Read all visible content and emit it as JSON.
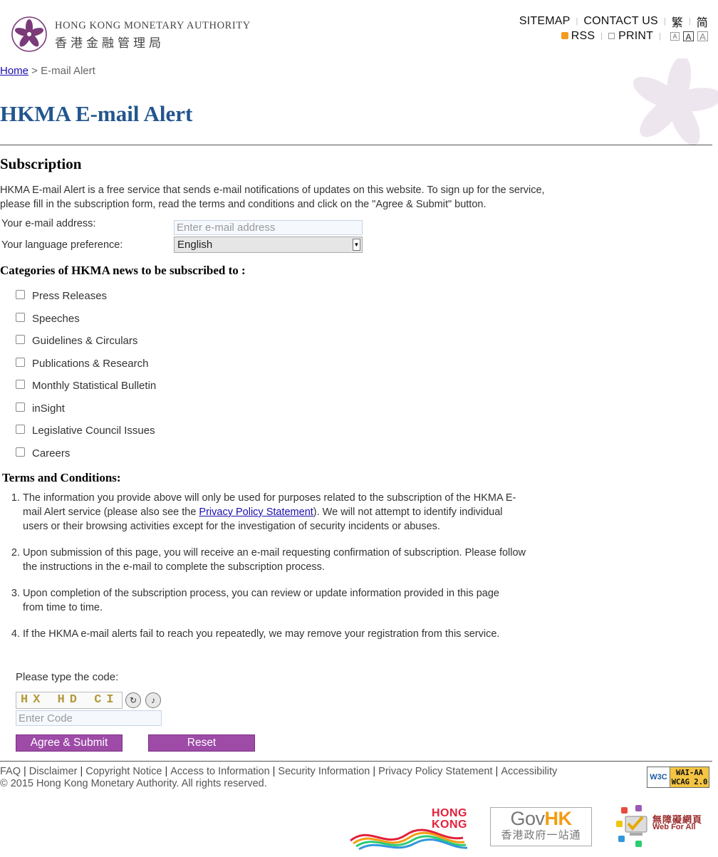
{
  "header": {
    "org_name_en": "HONG KONG MONETARY AUTHORITY",
    "org_name_zh": "香港金融管理局",
    "sitemap": "SITEMAP",
    "contact_us": "CONTACT US",
    "lang_tc": "繁",
    "lang_sc": "简",
    "rss": "RSS",
    "print": "PRINT",
    "font_small": "A",
    "font_medium": "A",
    "font_large": "A"
  },
  "breadcrumb": {
    "home": "Home",
    "separator": " > ",
    "current": "E-mail Alert"
  },
  "page": {
    "title": "HKMA E-mail Alert",
    "subscription_heading": "Subscription",
    "intro": "HKMA E-mail Alert is a free service that sends e-mail notifications of updates on this website. To sign up for the service, please fill in the subscription form, read the terms and conditions and click on the \"Agree & Submit\" button."
  },
  "form": {
    "email_label": "Your e-mail address:",
    "email_placeholder": "Enter e-mail address",
    "language_label": "Your language preference:",
    "language_selected": "English",
    "categories_heading": "Categories of HKMA news to be subscribed to :",
    "categories": [
      "Press Releases",
      "Speeches",
      "Guidelines & Circulars",
      "Publications & Research",
      "Monthly Statistical Bulletin",
      "inSight",
      "Legislative Council Issues",
      "Careers"
    ]
  },
  "terms": {
    "heading": "Terms and Conditions:",
    "item1_before": "The information you provide above will only be used for purposes related to the subscription of the HKMA E-mail Alert service (please also see the ",
    "item1_link": "Privacy Policy Statement",
    "item1_after": "). We will not attempt to identify individual users or their browsing activities except for the investigation of security incidents or abuses.",
    "item2": "Upon submission of this page, you will receive an e-mail requesting confirmation of subscription. Please follow the instructions in the e-mail to complete the subscription process.",
    "item3": "Upon completion of the subscription process, you can review or update information provided in this page from time to time.",
    "item4": "If the HKMA e-mail alerts fail to reach you repeatedly, we may remove your registration from this service."
  },
  "captcha": {
    "label": "Please type the code:",
    "code_image_text": "HX HD CI",
    "placeholder": "Enter Code"
  },
  "buttons": {
    "agree_submit": "Agree & Submit",
    "reset": "Reset"
  },
  "footer": {
    "links": [
      "FAQ",
      "Disclaimer",
      "Copyright Notice",
      "Access to Information",
      "Security Information",
      "Privacy Policy Statement",
      "Accessibility"
    ],
    "copyright": "© 2015 Hong Kong Monetary Authority. All rights reserved.",
    "wcag_badge_w3c": "W3C",
    "wcag_badge_line1": "WAI-AA",
    "wcag_badge_line2": "WCAG 2.0",
    "brand_hk_line1": "HONG",
    "brand_hk_line2": "KONG",
    "govhk_gov": "Gov",
    "govhk_hk": "HK",
    "govhk_zh": "香港政府一站通",
    "webforall_zh": "無障礙網頁",
    "webforall_en": "Web For All"
  },
  "colors": {
    "title_blue": "#23568f",
    "button_purple": "#9d4ba7",
    "link_blue": "#1a0dab",
    "logo_purple": "#7a3b78"
  }
}
